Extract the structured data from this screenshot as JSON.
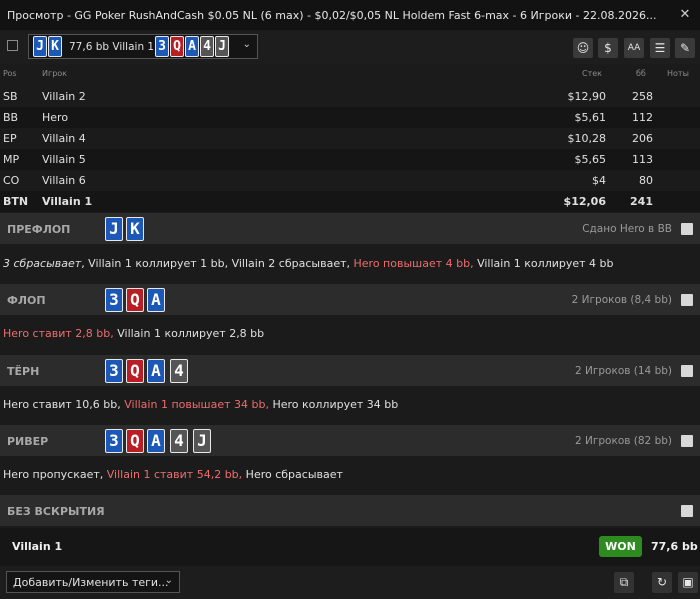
{
  "window": {
    "title": "Просмотр - GG Poker RushAndCash $0.05 NL (6 max) - $0,02/$0,05 NL Holdem Fast 6-max  - 6 Игроки - 22.08.2026...",
    "close_icon": "✕"
  },
  "toolbar": {
    "player_select": {
      "cards": [
        {
          "rank": "J",
          "color": "blue"
        },
        {
          "rank": "K",
          "color": "blue"
        }
      ],
      "text": "77,6 bb Villain 1",
      "board": [
        {
          "rank": "3",
          "color": "blue"
        },
        {
          "rank": "Q",
          "color": "red"
        },
        {
          "rank": "A",
          "color": "blue"
        },
        {
          "rank": "4",
          "color": "grey"
        },
        {
          "rank": "J",
          "color": "grey"
        }
      ]
    },
    "buttons": [
      {
        "name": "player-icon",
        "glyph": "☺"
      },
      {
        "name": "dollar-icon",
        "glyph": "$"
      },
      {
        "name": "font-size-icon",
        "glyph": "AA"
      },
      {
        "name": "list-icon",
        "glyph": "☰"
      },
      {
        "name": "pencil-icon",
        "glyph": "✎"
      }
    ]
  },
  "players_table": {
    "headers": {
      "pos": "Pos",
      "player": "Игрок",
      "stack": "Стек",
      "bb": "бб",
      "notes": "Ноты"
    },
    "rows": [
      {
        "pos": "SB",
        "name": "Villain 2",
        "stack": "$12,90",
        "bb": "258"
      },
      {
        "pos": "BB",
        "name": "Hero",
        "stack": "$5,61",
        "bb": "112"
      },
      {
        "pos": "EP",
        "name": "Villain 4",
        "stack": "$10,28",
        "bb": "206"
      },
      {
        "pos": "MP",
        "name": "Villain 5",
        "stack": "$5,65",
        "bb": "113"
      },
      {
        "pos": "CO",
        "name": "Villain 6",
        "stack": "$4",
        "bb": "80"
      },
      {
        "pos": "BTN",
        "name": "Villain 1",
        "stack": "$12,06",
        "bb": "241"
      }
    ]
  },
  "streets": {
    "preflop": {
      "name": "ПРЕФЛОП",
      "info": "Сдано Hero в BB",
      "cards": [
        {
          "rank": "J",
          "color": "blue"
        },
        {
          "rank": "K",
          "color": "blue"
        }
      ],
      "action_parts": [
        {
          "text": "3 сбрасывает",
          "style": "italic"
        },
        {
          "text": ", Villain 1 коллирует 1 bb, Villain 2 сбрасывает, ",
          "style": "normal"
        },
        {
          "text": "Hero повышает 4 bb,",
          "style": "red"
        },
        {
          "text": " Villain 1 коллирует 4 bb",
          "style": "normal"
        }
      ]
    },
    "flop": {
      "name": "ФЛОП",
      "info": "2 Игроков (8,4 bb)",
      "cards": [
        {
          "rank": "3",
          "color": "blue"
        },
        {
          "rank": "Q",
          "color": "red"
        },
        {
          "rank": "A",
          "color": "blue"
        }
      ],
      "action_parts": [
        {
          "text": "Hero ставит 2,8 bb,",
          "style": "red"
        },
        {
          "text": " Villain 1 коллирует 2,8 bb",
          "style": "normal"
        }
      ]
    },
    "turn": {
      "name": "ТЁРН",
      "info": "2 Игроков (14 bb)",
      "cards": [
        {
          "rank": "3",
          "color": "blue"
        },
        {
          "rank": "Q",
          "color": "red"
        },
        {
          "rank": "A",
          "color": "blue"
        },
        {
          "rank": "4",
          "color": "grey"
        }
      ],
      "action_parts": [
        {
          "text": "Hero ставит 10,6 bb, ",
          "style": "normal"
        },
        {
          "text": "Villain 1 повышает 34 bb,",
          "style": "red"
        },
        {
          "text": " Hero коллирует 34 bb",
          "style": "normal"
        }
      ]
    },
    "river": {
      "name": "РИВЕР",
      "info": "2 Игроков (82 bb)",
      "cards": [
        {
          "rank": "3",
          "color": "blue"
        },
        {
          "rank": "Q",
          "color": "red"
        },
        {
          "rank": "A",
          "color": "blue"
        },
        {
          "rank": "4",
          "color": "grey"
        },
        {
          "rank": "J",
          "color": "grey"
        }
      ],
      "action_parts": [
        {
          "text": "Hero пропускает, ",
          "style": "normal"
        },
        {
          "text": "Villain 1 ставит 54,2 bb,",
          "style": "red"
        },
        {
          "text": " Hero сбрасывает",
          "style": "normal"
        }
      ]
    },
    "showdown": {
      "name": "БЕЗ ВСКРЫТИЯ"
    }
  },
  "result": {
    "winner": "Villain 1",
    "badge": "WON",
    "amount": "77,6 bb"
  },
  "footer": {
    "tags_label": "Добавить/Изменить теги...",
    "buttons": [
      {
        "name": "copy-icon",
        "glyph": "⧉"
      },
      {
        "name": "replay-icon",
        "glyph": "↻"
      },
      {
        "name": "save-icon",
        "glyph": "▣"
      }
    ]
  },
  "colors": {
    "card_blue": "#1c58b8",
    "card_red": "#b81e23",
    "card_grey": "#555555",
    "won_green": "#2e8b1f",
    "action_red": "#ef6d6d"
  }
}
